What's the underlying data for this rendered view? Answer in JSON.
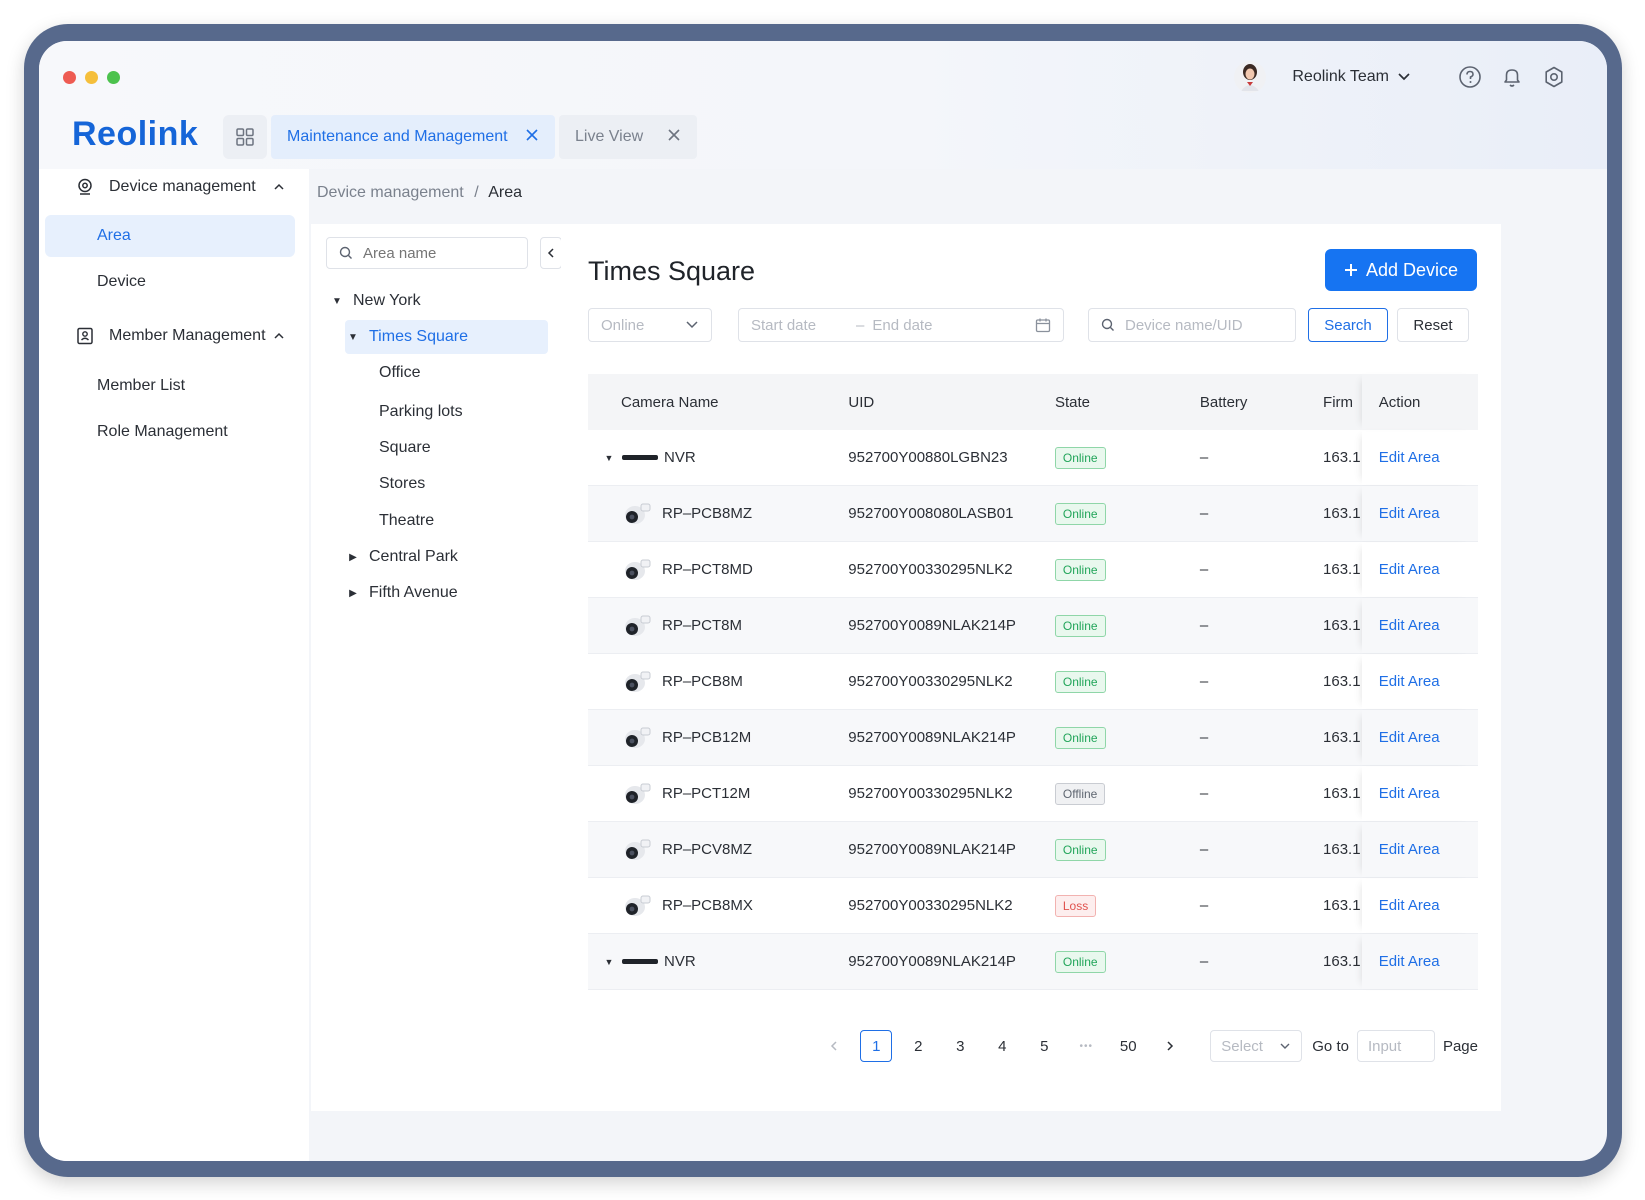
{
  "window": {
    "traffic_lights": [
      "#ee5b52",
      "#f5bf3b",
      "#4cc24d"
    ]
  },
  "brand": {
    "logo_text": "Reolink",
    "accent": "#1674f2"
  },
  "tabs": [
    {
      "label": "Maintenance and Management",
      "active": true
    },
    {
      "label": "Live View",
      "active": false
    }
  ],
  "header": {
    "team_label": "Reolink Team",
    "icons": [
      "help-icon",
      "bell-icon",
      "gear-icon"
    ]
  },
  "sidebar": {
    "groups": [
      {
        "label": "Device management",
        "icon": "location-icon",
        "items": [
          {
            "label": "Area",
            "selected": true
          },
          {
            "label": "Device",
            "selected": false
          }
        ]
      },
      {
        "label": "Member Management",
        "icon": "id-card-icon",
        "items": [
          {
            "label": "Member List",
            "selected": false
          },
          {
            "label": "Role Management",
            "selected": false
          }
        ]
      }
    ]
  },
  "breadcrumb": {
    "parent": "Device management",
    "separator": "/",
    "current": "Area"
  },
  "area_tree": {
    "search_placeholder": "Area name",
    "nodes": [
      {
        "label": "New York",
        "expanded": true
      },
      {
        "label": "Times Square",
        "expanded": true,
        "selected": true
      },
      {
        "label": "Office"
      },
      {
        "label": "Parking lots"
      },
      {
        "label": "Square"
      },
      {
        "label": "Stores"
      },
      {
        "label": "Theatre"
      },
      {
        "label": "Central Park",
        "expanded": false
      },
      {
        "label": "Fifth Avenue",
        "expanded": false
      }
    ]
  },
  "main": {
    "title": "Times Square",
    "add_button": "Add Device",
    "filters": {
      "status_value": "Online",
      "start_date_placeholder": "Start date",
      "date_separator": "–",
      "end_date_placeholder": "End date",
      "device_placeholder": "Device name/UID",
      "search_label": "Search",
      "reset_label": "Reset"
    },
    "table": {
      "columns": [
        "Camera Name",
        "UID",
        "State",
        "Battery",
        "Firm",
        "Action"
      ],
      "rows": [
        {
          "name": "NVR",
          "type": "nvr",
          "uid": "952700Y00880LGBN23",
          "state": "Online",
          "battery": "–",
          "firm": "163.1",
          "action": "Edit Area"
        },
        {
          "name": "RP–PCB8MZ",
          "type": "cam",
          "uid": "952700Y008080LASB01",
          "state": "Online",
          "battery": "–",
          "firm": "163.1",
          "action": "Edit Area"
        },
        {
          "name": "RP–PCT8MD",
          "type": "cam",
          "uid": "952700Y00330295NLK2",
          "state": "Online",
          "battery": "–",
          "firm": "163.1",
          "action": "Edit Area"
        },
        {
          "name": "RP–PCT8M",
          "type": "cam",
          "uid": "952700Y0089NLAK214P",
          "state": "Online",
          "battery": "–",
          "firm": "163.1",
          "action": "Edit Area"
        },
        {
          "name": "RP–PCB8M",
          "type": "cam",
          "uid": "952700Y00330295NLK2",
          "state": "Online",
          "battery": "–",
          "firm": "163.1",
          "action": "Edit Area"
        },
        {
          "name": "RP–PCB12M",
          "type": "cam",
          "uid": "952700Y0089NLAK214P",
          "state": "Online",
          "battery": "–",
          "firm": "163.1",
          "action": "Edit Area"
        },
        {
          "name": "RP–PCT12M",
          "type": "cam",
          "uid": "952700Y00330295NLK2",
          "state": "Offline",
          "battery": "–",
          "firm": "163.1",
          "action": "Edit Area"
        },
        {
          "name": "RP–PCV8MZ",
          "type": "cam",
          "uid": "952700Y0089NLAK214P",
          "state": "Online",
          "battery": "–",
          "firm": "163.1",
          "action": "Edit Area"
        },
        {
          "name": "RP–PCB8MX",
          "type": "cam",
          "uid": "952700Y00330295NLK2",
          "state": "Loss",
          "battery": "–",
          "firm": "163.1",
          "action": "Edit Area"
        },
        {
          "name": "NVR",
          "type": "nvr",
          "uid": "952700Y0089NLAK214P",
          "state": "Online",
          "battery": "–",
          "firm": "163.1",
          "action": "Edit Area"
        }
      ]
    },
    "pagination": {
      "pages": [
        "1",
        "2",
        "3",
        "4",
        "5"
      ],
      "current": "1",
      "ellipsis": "•••",
      "last": "50",
      "page_size_placeholder": "Select",
      "goto_label": "Go to",
      "goto_placeholder": "Input",
      "page_label": "Page"
    }
  }
}
